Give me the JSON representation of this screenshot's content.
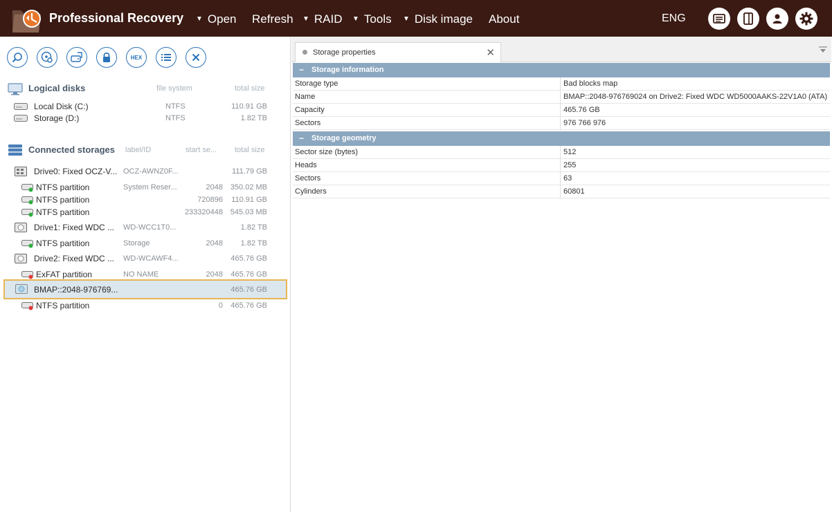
{
  "app": {
    "title": "Professional Recovery",
    "lang": "ENG"
  },
  "menu": {
    "open": "Open",
    "refresh": "Refresh",
    "raid": "RAID",
    "tools": "Tools",
    "disk_image": "Disk image",
    "about": "About",
    "dropdown_marker": "▼"
  },
  "toolbar": {
    "hex_label": "HEX"
  },
  "logical": {
    "title": "Logical disks",
    "col_fs": "file system",
    "col_size": "total size",
    "items": [
      {
        "name": "Local Disk (C:)",
        "fs": "NTFS",
        "size": "110.91 GB"
      },
      {
        "name": "Storage (D:)",
        "fs": "NTFS",
        "size": "1.82 TB"
      }
    ]
  },
  "connected": {
    "title": "Connected storages",
    "col_label": "label/ID",
    "col_start": "start se...",
    "col_size": "total size",
    "items": [
      {
        "name": "Drive0: Fixed OCZ-V...",
        "label": "OCZ-AWNZ0F...",
        "start": "",
        "size": "111.79 GB"
      },
      {
        "name": "NTFS partition",
        "label": "System Reser...",
        "start": "2048",
        "size": "350.02 MB"
      },
      {
        "name": "NTFS partition",
        "label": "",
        "start": "720896",
        "size": "110.91 GB"
      },
      {
        "name": "NTFS partition",
        "label": "",
        "start": "233320448",
        "size": "545.03 MB"
      },
      {
        "name": "Drive1: Fixed WDC ...",
        "label": "WD-WCC1T0...",
        "start": "",
        "size": "1.82 TB"
      },
      {
        "name": "NTFS partition",
        "label": "Storage",
        "start": "2048",
        "size": "1.82 TB"
      },
      {
        "name": "Drive2: Fixed WDC ...",
        "label": "WD-WCAWF4...",
        "start": "",
        "size": "465.76 GB"
      },
      {
        "name": "ExFAT partition",
        "label": "NO NAME",
        "start": "2048",
        "size": "465.76 GB"
      },
      {
        "name": "BMAP::2048-976769...",
        "label": "",
        "start": "",
        "size": "465.76 GB"
      },
      {
        "name": "NTFS partition",
        "label": "",
        "start": "0",
        "size": "465.76 GB"
      }
    ]
  },
  "tab": {
    "label": "Storage properties",
    "close": "✕"
  },
  "props": {
    "info_title": "Storage information",
    "geometry_title": "Storage geometry",
    "collapse": "−",
    "info": [
      {
        "k": "Storage type",
        "v": "Bad blocks map"
      },
      {
        "k": "Name",
        "v": "BMAP::2048-976769024 on Drive2: Fixed WDC WD5000AAKS-22V1A0 (ATA)"
      },
      {
        "k": "Capacity",
        "v": "465.76 GB"
      },
      {
        "k": "Sectors",
        "v": "976 766 976"
      }
    ],
    "geometry": [
      {
        "k": "Sector size (bytes)",
        "v": "512"
      },
      {
        "k": "Heads",
        "v": "255"
      },
      {
        "k": "Sectors",
        "v": "63"
      },
      {
        "k": "Cylinders",
        "v": "60801"
      }
    ]
  }
}
